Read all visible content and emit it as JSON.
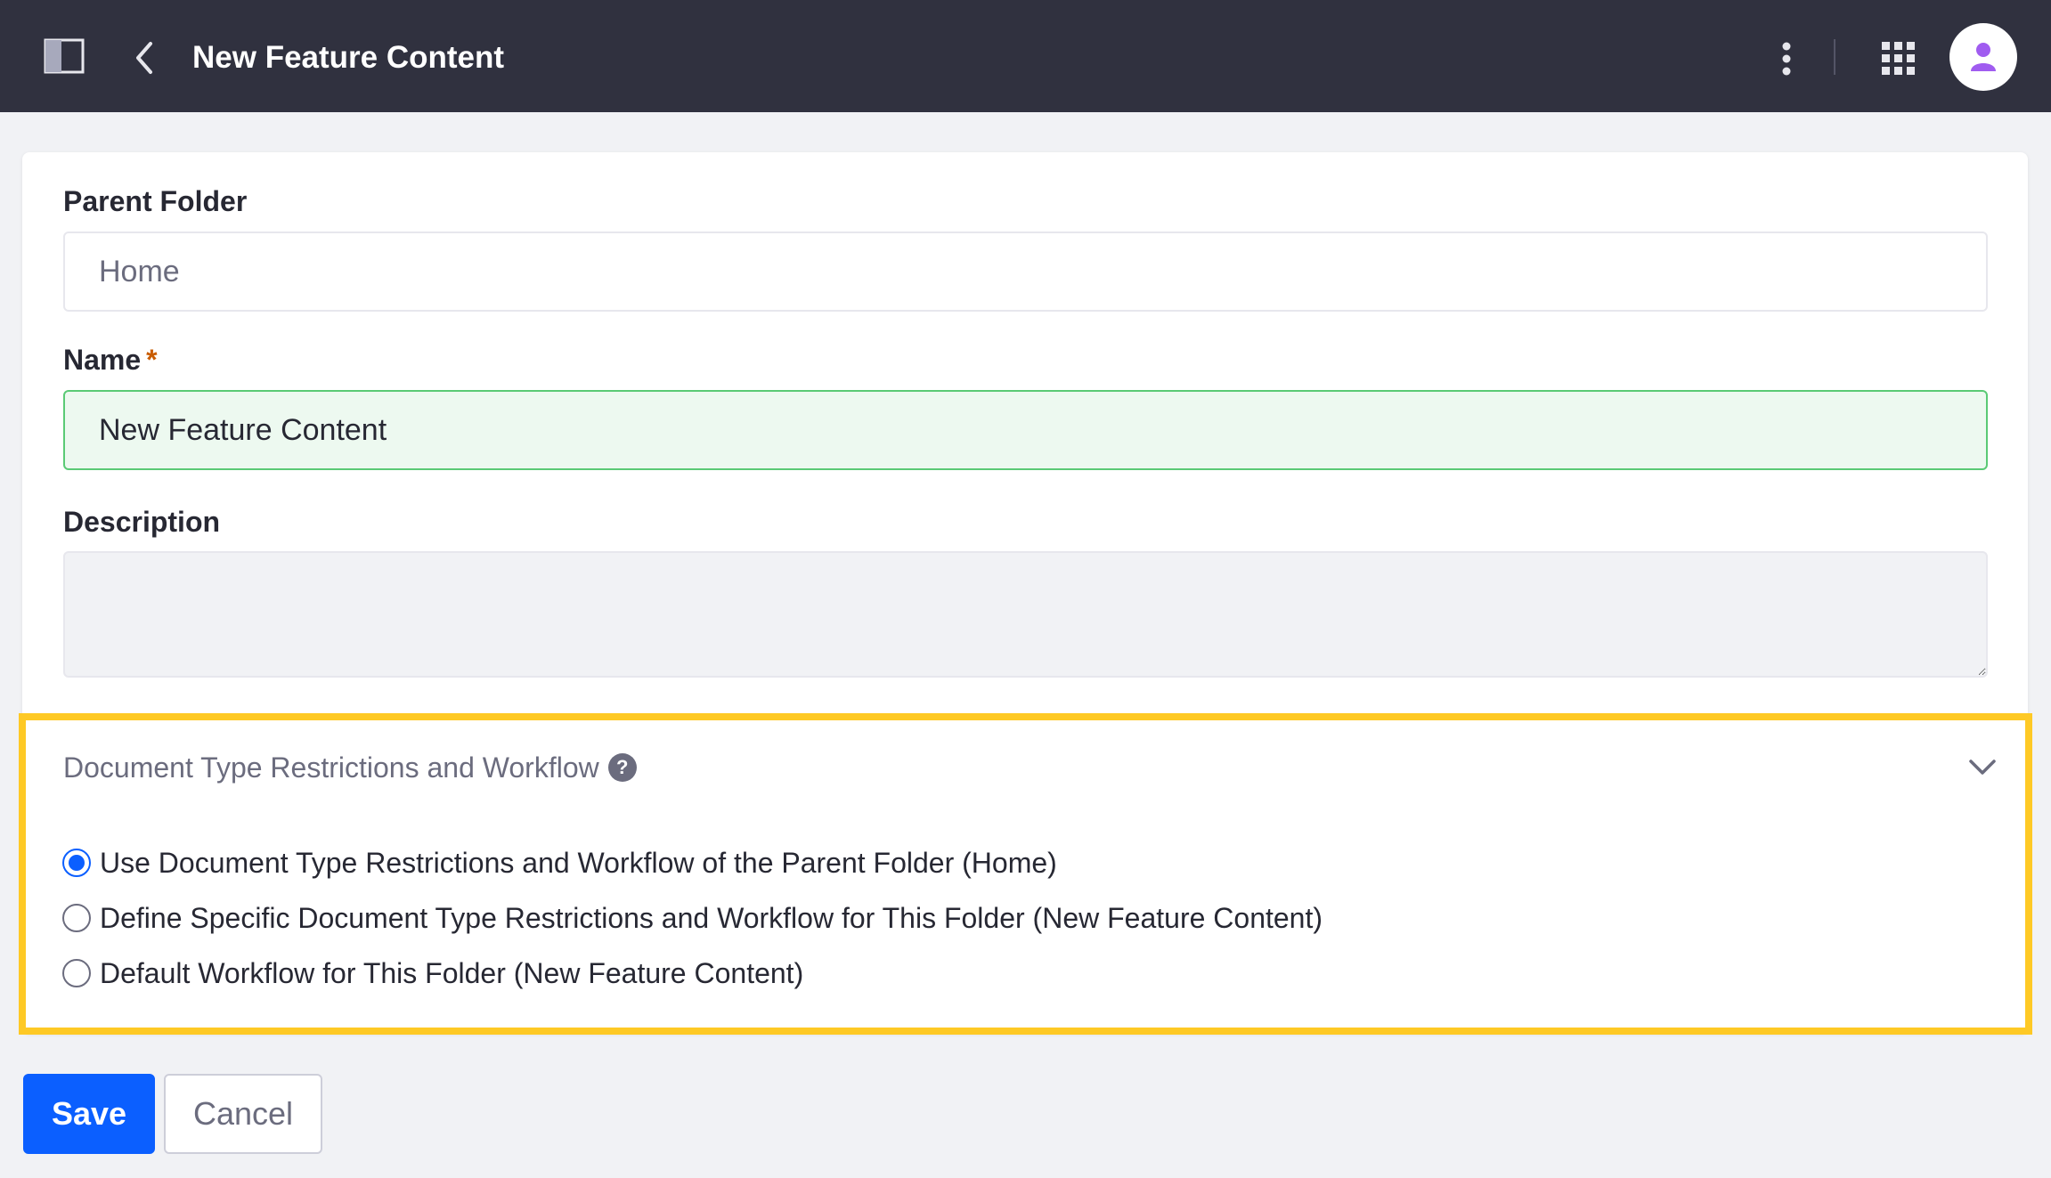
{
  "header": {
    "title": "New Feature Content",
    "icons": {
      "sidebar_toggle": "sidebar-toggle-icon",
      "back": "chevron-left-icon",
      "more": "kebab-menu-icon",
      "apps": "apps-grid-icon",
      "avatar": "user-icon"
    }
  },
  "form": {
    "parent_folder": {
      "label": "Parent Folder",
      "value": "Home"
    },
    "name": {
      "label": "Name",
      "required_marker": "*",
      "value": "New Feature Content"
    },
    "description": {
      "label": "Description",
      "value": ""
    }
  },
  "workflow_section": {
    "title": "Document Type Restrictions and Workflow",
    "help_icon": "?",
    "expanded": true,
    "options": [
      {
        "label": "Use Document Type Restrictions and Workflow of the Parent Folder (Home)",
        "checked": true
      },
      {
        "label": "Define Specific Document Type Restrictions and Workflow for This Folder (New Feature Content)",
        "checked": false
      },
      {
        "label": "Default Workflow for This Folder (New Feature Content)",
        "checked": false
      }
    ]
  },
  "actions": {
    "save_label": "Save",
    "cancel_label": "Cancel"
  },
  "colors": {
    "topbar": "#30313f",
    "primary": "#0b5fff",
    "highlight": "#fec925",
    "success_border": "#5aca75",
    "avatar_accent": "#a05cf0"
  }
}
